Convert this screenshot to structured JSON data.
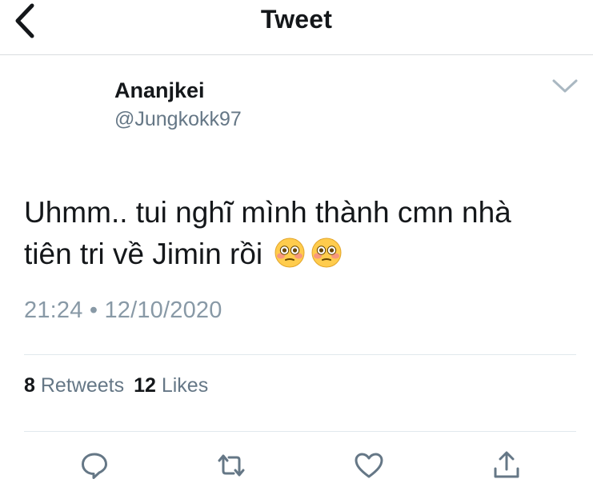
{
  "header": {
    "title": "Tweet",
    "back_icon": "chevron-left-icon"
  },
  "author": {
    "name": "Ananjkei",
    "handle": "@Jungkokk97"
  },
  "menu": {
    "icon": "chevron-down-icon"
  },
  "tweet": {
    "line1": "Uhmm.. tui nghĩ mình thành cmn nhà",
    "line2": "tiên tri về Jimin rồi",
    "emojis": [
      "flushed-face-emoji",
      "flushed-face-emoji"
    ]
  },
  "timestamp": "21:24 • 12/10/2020",
  "stats": {
    "retweets_count": "8",
    "retweets_label": "Retweets",
    "likes_count": "12",
    "likes_label": "Likes"
  },
  "actions": {
    "reply_icon": "reply-icon",
    "retweet_icon": "retweet-icon",
    "like_icon": "heart-icon",
    "share_icon": "share-icon"
  },
  "colors": {
    "primary_text": "#14171a",
    "secondary_text": "#657786",
    "accent": "#1da1f2",
    "divider": "#e1e8ed"
  }
}
